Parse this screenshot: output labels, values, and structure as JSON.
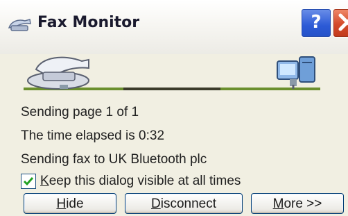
{
  "window": {
    "title": "Fax Monitor",
    "help_label": "?",
    "icons": [
      "fax-monitor-icon",
      "help-icon",
      "close-icon",
      "fax-machine-icon",
      "computer-icon"
    ]
  },
  "progress": {
    "fraction": 0.5
  },
  "status": {
    "line1": "Sending page 1 of 1",
    "line2": "The time elapsed is 0:32",
    "line3": "Sending fax to UK Bluetooth plc"
  },
  "options": {
    "keep_visible": {
      "checked": true,
      "label_first": "K",
      "label_rest": "eep this dialog visible at all times"
    }
  },
  "buttons": {
    "hide": {
      "first": "H",
      "rest": "ide"
    },
    "disconnect": {
      "first": "D",
      "rest": "isconnect"
    },
    "more": {
      "first": "M",
      "rest": "ore >>"
    }
  },
  "colors": {
    "accent": "#2c5ad6",
    "close": "#d44a2a",
    "progress_line": "#6b8f2e"
  }
}
